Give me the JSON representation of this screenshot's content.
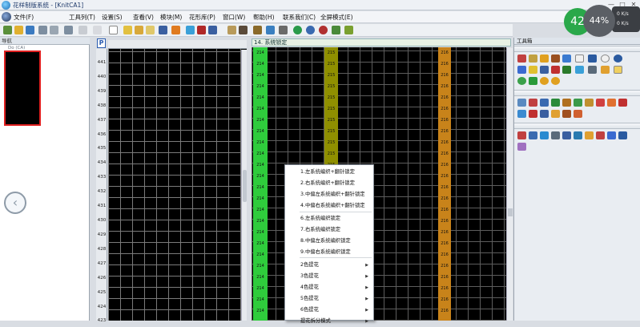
{
  "window": {
    "title": "花样制版系统 - [KnitCA1]",
    "controls": [
      "—",
      "□",
      "✕"
    ]
  },
  "menu": {
    "items": [
      "文件(F)",
      "工具列(T)",
      "设置(S)",
      "查看(V)",
      "模块(M)",
      "花形库(P)",
      "窗口(W)",
      "帮助(H)",
      "联系我们(C)",
      "全屏模式(E)"
    ]
  },
  "nav": {
    "title": "导航",
    "thumb_label": "Do (CA)"
  },
  "toolbox": {
    "title": "工具箱"
  },
  "left_editor": {
    "tab": "P",
    "row_numbers": [
      "441",
      "440",
      "439",
      "438",
      "437",
      "436",
      "435",
      "434",
      "433",
      "432",
      "431",
      "430",
      "429",
      "428",
      "427",
      "426",
      "425",
      "424",
      "423"
    ]
  },
  "right_editor": {
    "title": "14. 系统锁定",
    "columns": [
      {
        "color": "#2fcc3c",
        "label": "214"
      },
      {
        "color": "#8f8f00",
        "label": "215"
      },
      {
        "color": "#c8831a",
        "label": "216"
      }
    ]
  },
  "context_menu": {
    "items": [
      {
        "label": "1.左系统编织+翻针锁定",
        "submenu": false
      },
      {
        "label": "2.右系统编织+翻针锁定",
        "submenu": false
      },
      {
        "label": "3.中偏左系统编织+翻针锁定",
        "submenu": false
      },
      {
        "label": "4.中偏右系统编织+翻针锁定",
        "submenu": false
      },
      {
        "label": "6.左系统编织锁定",
        "submenu": false
      },
      {
        "label": "7.右系统编织锁定",
        "submenu": false
      },
      {
        "label": "8.中偏左系统编织锁定",
        "submenu": false
      },
      {
        "label": "9.中偏右系统编织锁定",
        "submenu": false
      },
      {
        "label": "2色提花",
        "submenu": true
      },
      {
        "label": "3色提花",
        "submenu": true
      },
      {
        "label": "4色提花",
        "submenu": true
      },
      {
        "label": "5色提花",
        "submenu": true
      },
      {
        "label": "6色提花",
        "submenu": true
      },
      {
        "label": "提花拆分模式",
        "submenu": true
      }
    ]
  },
  "speed_widget": {
    "cpu": "42",
    "mem": "44%",
    "up": "0 K/s",
    "down": "0 K/s"
  },
  "colors": {
    "green_column": "#2fcc3c",
    "olive_column": "#8f8f00",
    "orange_column": "#c8831a",
    "grid_bg": "#000000",
    "nav_highlight": "#e02020"
  }
}
